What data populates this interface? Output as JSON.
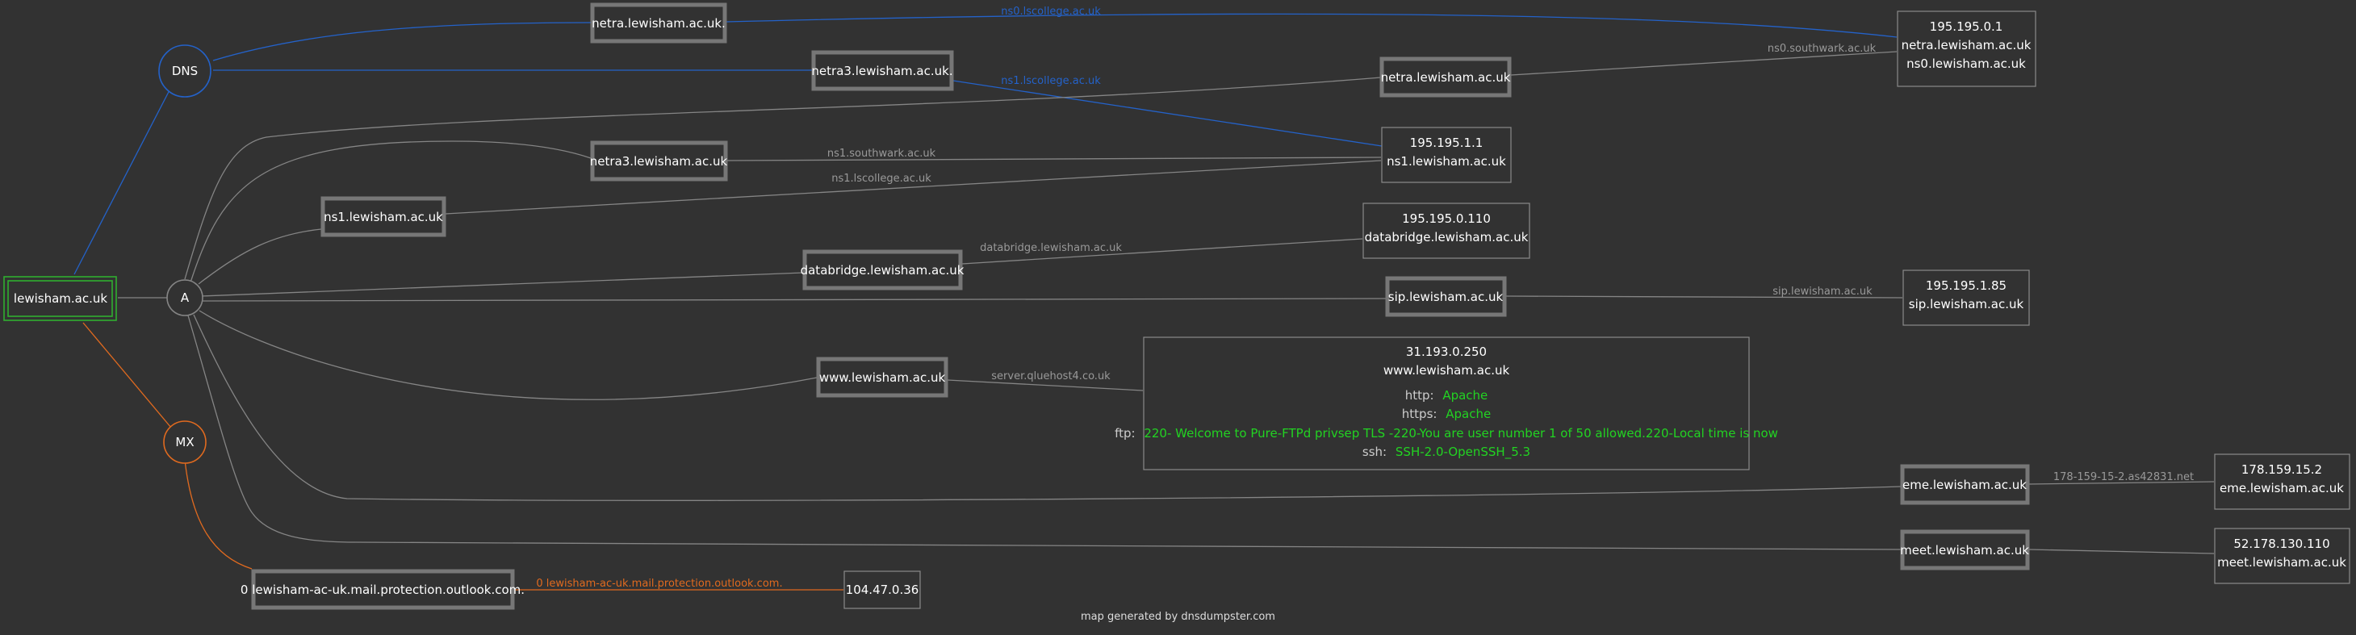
{
  "colors": {
    "background": "#323232",
    "dns_edge": "#2462c9",
    "mx_edge": "#e06a1f",
    "a_edge": "#858585",
    "root_border": "#2fae2f",
    "node_border": "#777777",
    "service_value": "#22d322"
  },
  "root": {
    "label": "lewisham.ac.uk"
  },
  "groups": {
    "dns": "DNS",
    "a": "A",
    "mx": "MX"
  },
  "hosts": {
    "netra_dns": "netra.lewisham.ac.uk.",
    "netra3_dns": "netra3.lewisham.ac.uk.",
    "netra_a": "netra.lewisham.ac.uk",
    "netra3_a": "netra3.lewisham.ac.uk",
    "ns1_a": "ns1.lewisham.ac.uk",
    "databridge_a": "databridge.lewisham.ac.uk",
    "sip_a": "sip.lewisham.ac.uk",
    "www_a": "www.lewisham.ac.uk",
    "eme_a": "eme.lewisham.ac.uk",
    "meet_a": "meet.lewisham.ac.uk",
    "mx_host": "0 lewisham-ac-uk.mail.protection.outlook.com."
  },
  "edge_labels": {
    "ns0_lscollege": "ns0.lscollege.ac.uk",
    "ns1_lscollege_blue": "ns1.lscollege.ac.uk",
    "ns0_southwark": "ns0.southwark.ac.uk",
    "ns1_southwark": "ns1.southwark.ac.uk",
    "ns1_lscollege_grey": "ns1.lscollege.ac.uk",
    "databridge_rev": "databridge.lewisham.ac.uk",
    "sip_rev": "sip.lewisham.ac.uk",
    "www_rev": "server.qluehost4.co.uk",
    "eme_rev": "178-159-15-2.as42831.net",
    "mx_rev": "0 lewisham-ac-uk.mail.protection.outlook.com."
  },
  "ip_boxes": {
    "box0": [
      "195.195.0.1",
      "netra.lewisham.ac.uk",
      "ns0.lewisham.ac.uk"
    ],
    "box1": [
      "195.195.1.1",
      "ns1.lewisham.ac.uk"
    ],
    "box110": [
      "195.195.0.110",
      "databridge.lewisham.ac.uk"
    ],
    "box185": [
      "195.195.1.85",
      "sip.lewisham.ac.uk"
    ],
    "box250": [
      "31.193.0.250",
      "www.lewisham.ac.uk"
    ],
    "box_eme": [
      "178.159.15.2",
      "eme.lewisham.ac.uk"
    ],
    "box_meet": [
      "52.178.130.110",
      "meet.lewisham.ac.uk"
    ],
    "box_mx": [
      "104.47.0.36"
    ]
  },
  "services": [
    {
      "key": "http:",
      "value": "Apache"
    },
    {
      "key": "https:",
      "value": "Apache"
    },
    {
      "key": "ftp:",
      "value": "220- Welcome to Pure-FTPd privsep TLS -220-You are user number 1 of 50 allowed.220-Local time is now"
    },
    {
      "key": "ssh:",
      "value": "SSH-2.0-OpenSSH_5.3"
    }
  ],
  "footer": "map generated by dnsdumpster.com"
}
